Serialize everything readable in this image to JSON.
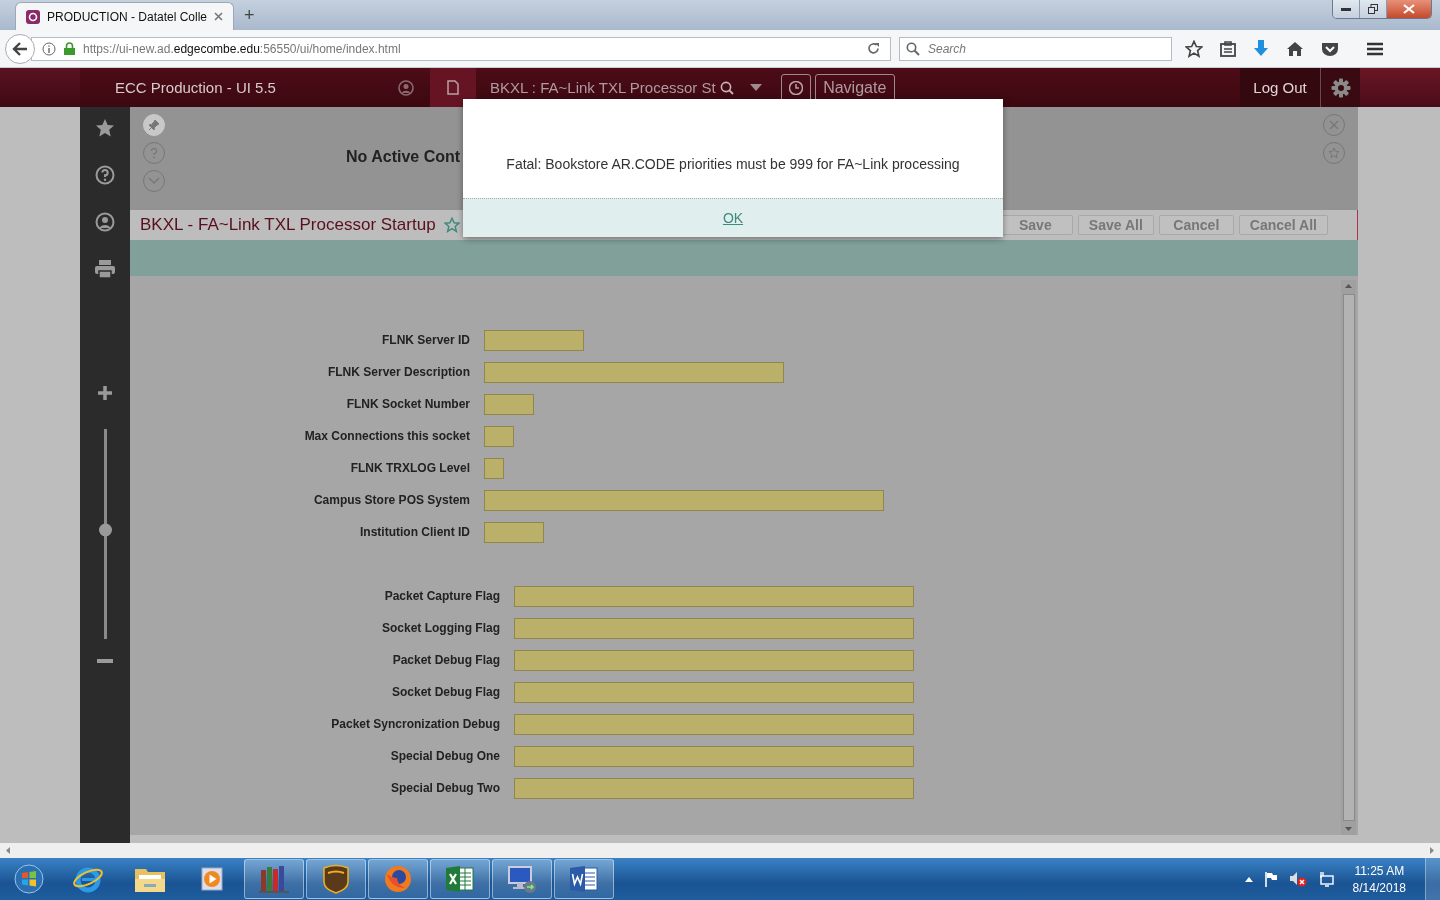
{
  "browser": {
    "tab_title": "PRODUCTION - Datatel Colle",
    "new_tab": "+",
    "url": "https://ui-new.ad.**edgecombe.edu**:56550/ui/home/index.html",
    "search": {
      "placeholder": "Search"
    }
  },
  "app_header": {
    "product": "ECC Production - UI 5.5",
    "form_search": "BKXL : FA~Link TXL Processor St",
    "navigate": "Navigate",
    "logout": "Log Out"
  },
  "sidebar": {
    "zoom_slider": {
      "level": 0.52
    }
  },
  "context_header": {
    "title": "No Active Cont"
  },
  "form": {
    "title": "BKXL - FA~Link TXL Processor Startup",
    "buttons": [
      {
        "label": "Save",
        "disabled": true
      },
      {
        "label": "Save All",
        "disabled": true
      },
      {
        "label": "Cancel",
        "disabled": true
      },
      {
        "label": "Cancel All",
        "disabled": true
      }
    ],
    "groups": [
      {
        "fields": [
          {
            "label": "FLNK Server ID"
          },
          {
            "label": "FLNK Server Description"
          },
          {
            "label": "FLNK Socket Number"
          },
          {
            "label": "Max Connections this socket"
          },
          {
            "label": "FLNK TRXLOG Level"
          },
          {
            "label": "Campus Store POS System"
          },
          {
            "label": "Institution Client ID"
          }
        ]
      },
      {
        "fields": [
          {
            "label": "Packet Capture Flag"
          },
          {
            "label": "Socket Logging Flag"
          },
          {
            "label": "Packet Debug Flag"
          },
          {
            "label": "Socket Debug Flag"
          },
          {
            "label": "Packet Syncronization Debug"
          },
          {
            "label": "Special Debug One"
          },
          {
            "label": "Special Debug Two"
          }
        ]
      }
    ]
  },
  "dialog": {
    "message": "Fatal: Bookstore AR.CODE priorities must be 999 for FA~Link processing",
    "ok": "OK"
  },
  "taskbar": {
    "apps": [
      {
        "kind": "ie",
        "running": false
      },
      {
        "kind": "folder",
        "running": false
      },
      {
        "kind": "media",
        "running": false
      },
      {
        "kind": "books",
        "running": true
      },
      {
        "kind": "ups",
        "running": true
      },
      {
        "kind": "firefox",
        "running": true
      },
      {
        "kind": "excel",
        "running": true
      },
      {
        "kind": "remote",
        "running": true
      },
      {
        "kind": "word",
        "running": true
      }
    ],
    "time": "11:25 AM",
    "date": "8/14/2018"
  }
}
